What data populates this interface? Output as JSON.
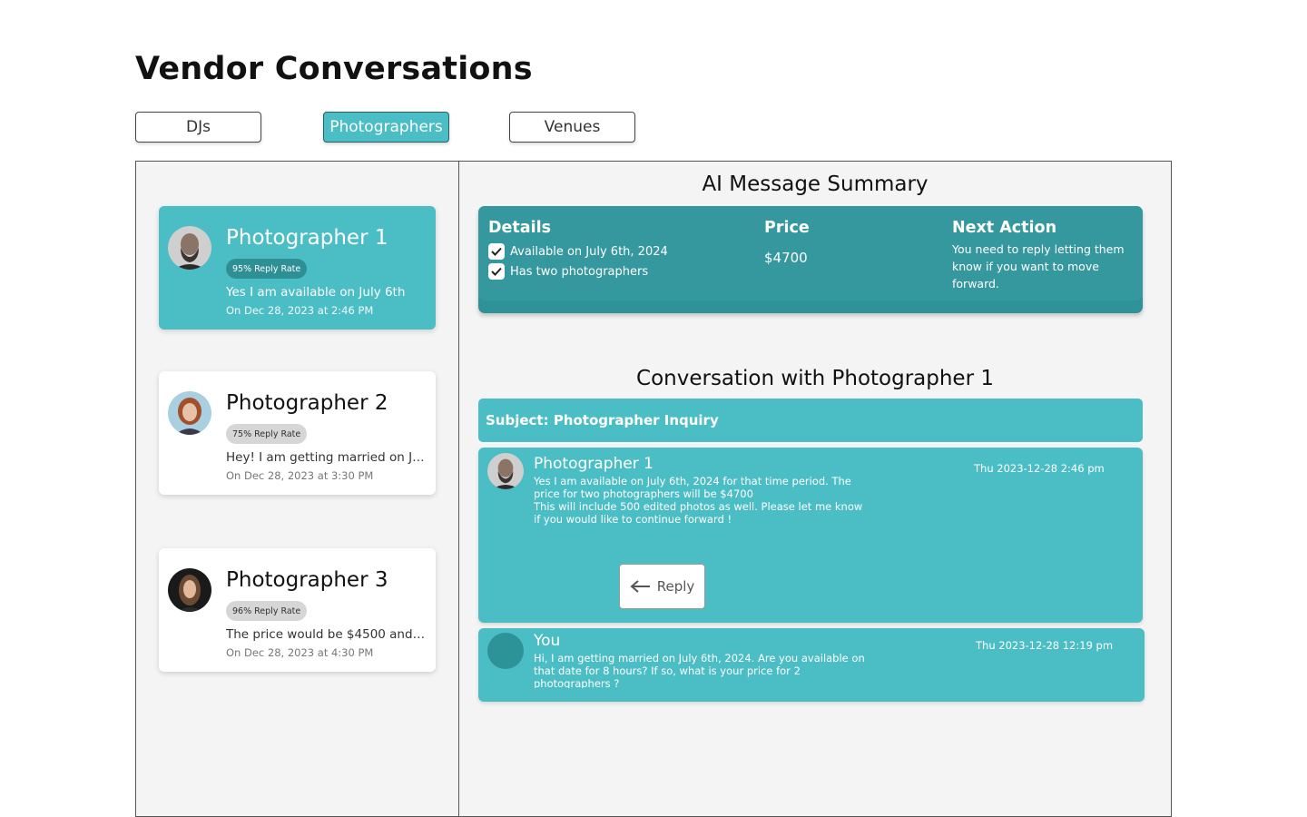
{
  "page": {
    "title": "Vendor Conversations"
  },
  "tabs": [
    {
      "label": "DJs",
      "active": false
    },
    {
      "label": "Photographers",
      "active": true
    },
    {
      "label": "Venues",
      "active": false
    }
  ],
  "vendors": [
    {
      "name": "Photographer 1",
      "reply_rate": "95% Reply Rate",
      "preview": "Yes I am available on July 6th",
      "date": "On Dec 28, 2023 at 2:46 PM",
      "selected": true
    },
    {
      "name": "Photographer 2",
      "reply_rate": "75% Reply Rate",
      "preview": "Hey! I am getting married on Ju ...",
      "date": "On Dec 28, 2023 at 3:30 PM",
      "selected": false
    },
    {
      "name": "Photographer 3",
      "reply_rate": "96% Reply Rate",
      "preview": "The price would be $4500 and t...",
      "date": "On Dec 28, 2023 at 4:30 PM",
      "selected": false
    }
  ],
  "summary": {
    "title": "AI Message Summary",
    "details_label": "Details",
    "details": [
      "Available on July 6th, 2024",
      "Has two photographers"
    ],
    "price_label": "Price",
    "price": "$4700",
    "next_action_label": "Next Action",
    "next_action": "You need to reply letting them know if you want to move forward."
  },
  "conversation": {
    "title": "Conversation with Photographer 1",
    "subject": "Subject: Photographer Inquiry",
    "messages": [
      {
        "sender": "Photographer 1",
        "body_line1": "Yes I am available on July 6th, 2024 for that time period. The price for two photographers will be $4700",
        "body_line2": "This will include 500 edited photos as well. Please let me know if you would like to continue forward !",
        "time": "Thu 2023-12-28 2:46 pm",
        "reply_label": "Reply"
      },
      {
        "sender": "You",
        "body_line1": "Hi, I am getting married on July 6th, 2024. Are you available on that date for 8 hours? If so, what is your price for 2 photographers ?",
        "time": "Thu 2023-12-28 12:19 pm"
      }
    ]
  },
  "colors": {
    "accent": "#4bbdc4",
    "accent_dark": "#35989e",
    "panel_bg": "#f4f4f4"
  }
}
